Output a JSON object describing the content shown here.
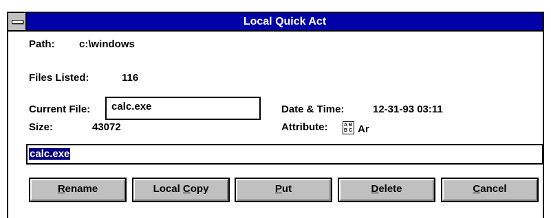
{
  "window": {
    "title": "Local Quick Act"
  },
  "path": {
    "label": "Path:",
    "value": "c:\\windows"
  },
  "files_listed": {
    "label": "Files Listed:",
    "value": "116"
  },
  "current_file": {
    "label": "Current File:",
    "value": "calc.exe"
  },
  "date_time": {
    "label": "Date & Time:",
    "value": "12-31-93 03:11"
  },
  "size": {
    "label": "Size:",
    "value": "43072"
  },
  "attribute": {
    "label": "Attribute:",
    "icon": "attribute-icon",
    "value": "Ar"
  },
  "edit_field": {
    "value": "calc.exe"
  },
  "buttons": {
    "rename": {
      "mnemonic": "R",
      "rest": "ename"
    },
    "local_copy": {
      "pre": "Local ",
      "mnemonic": "C",
      "rest": "opy"
    },
    "put": {
      "mnemonic": "P",
      "rest": "ut"
    },
    "delete": {
      "mnemonic": "D",
      "rest": "elete"
    },
    "cancel": {
      "mnemonic": "C",
      "rest": "ancel"
    }
  },
  "colors": {
    "titlebar": "#0000a8",
    "selection": "#000080",
    "button_face": "#c0c0c0"
  }
}
